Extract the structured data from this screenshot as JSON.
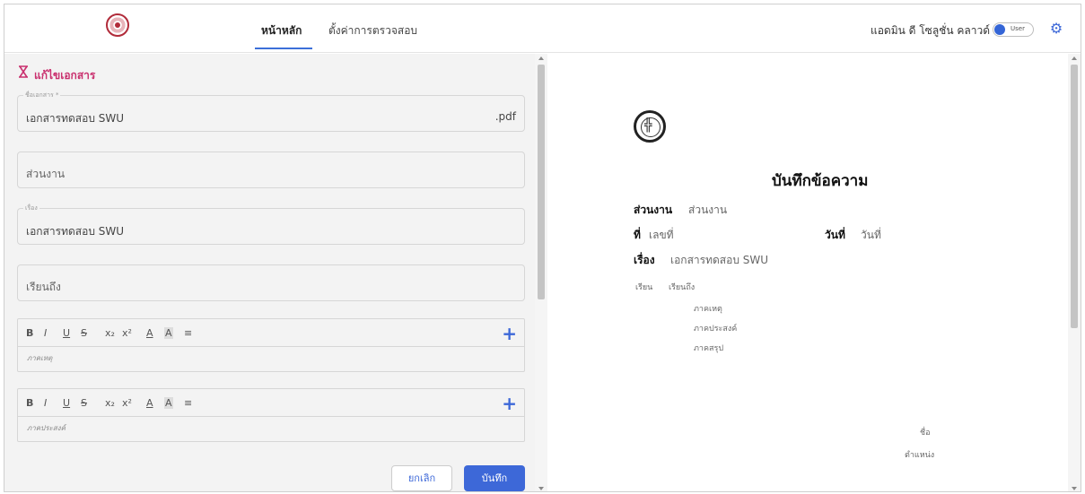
{
  "header": {
    "tabs": [
      {
        "label": "หน้าหลัก",
        "active": true
      },
      {
        "label": "ตั้งค่าการตรวจสอบ",
        "active": false
      }
    ],
    "user_name": "แอดมิน ดี โซลูชั่น คลาวด์",
    "toggle_label": "User",
    "accent": "#3d68d8"
  },
  "form": {
    "title": "แก้ไขเอกสาร",
    "doc_name": {
      "label": "ชื่อเอกสาร *",
      "value": "เอกสารทดสอบ SWU",
      "suffix": ".pdf"
    },
    "department": {
      "placeholder": "ส่วนงาน"
    },
    "subject": {
      "label": "เรื่อง",
      "value": "เอกสารทดสอบ SWU"
    },
    "to": {
      "placeholder": "เรียนถึง"
    },
    "editors": [
      {
        "placeholder": "ภาคเหตุ"
      },
      {
        "placeholder": "ภาคประสงค์"
      }
    ],
    "toolbar": {
      "bold": "B",
      "italic": "I",
      "underline": "U",
      "strike": "S",
      "sub": "x₂",
      "sup": "x²",
      "color": "A",
      "bg": "A",
      "align": "≡",
      "add": "+"
    },
    "cancel_label": "ยกเลิก",
    "save_label": "บันทึก"
  },
  "preview": {
    "title": "บันทึกข้อความ",
    "dept_label": "ส่วนงาน",
    "dept_value": "ส่วนงาน",
    "no_label": "ที่",
    "no_value": "เลขที่",
    "date_label": "วันที่",
    "date_value": "วันที่",
    "subject_label": "เรื่อง",
    "subject_value": "เอกสารทดสอบ SWU",
    "to_label": "เรียน",
    "to_value": "เรียนถึง",
    "body": [
      "ภาคเหตุ",
      "ภาคประสงค์",
      "ภาคสรุป"
    ],
    "sign_name": "ชื่อ",
    "sign_position": "ตำแหน่ง"
  }
}
